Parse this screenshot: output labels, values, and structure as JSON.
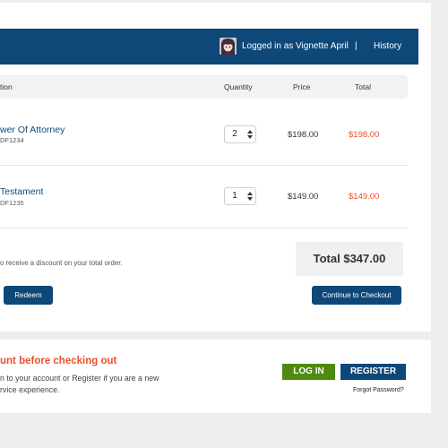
{
  "header": {
    "logged_in_text": "Logged in as Vignette April",
    "separator": "|",
    "history_link": "History"
  },
  "cart": {
    "columns": {
      "description": "tion",
      "quantity": "Quantity",
      "price": "Price",
      "total": "Total"
    },
    "items": [
      {
        "name": "wer Of Attorney",
        "sku": "DF1234",
        "quantity": "2",
        "price": "$198.00",
        "total": "$198.00"
      },
      {
        "name": "Testament",
        "sku": "DF1235",
        "quantity": "1",
        "price": "$149.00",
        "total": "$149.00"
      }
    ],
    "discount_text": "o receive a discount on your total order.",
    "grand_total": "Total $347.00",
    "redeem_label": "Redeem",
    "checkout_label": "Continue to Checkout"
  },
  "account": {
    "heading": "unt before checking out",
    "line1": "n to your account or Register if you are a new",
    "line2": "rvice experience.",
    "login_label": "LOG IN",
    "register_label": "REGISTER",
    "forgot_label": "Forgot Password?"
  },
  "colors": {
    "brand_blue": "#0e4879",
    "accent_orange": "#e8502a",
    "login_green": "#4f8a10"
  }
}
